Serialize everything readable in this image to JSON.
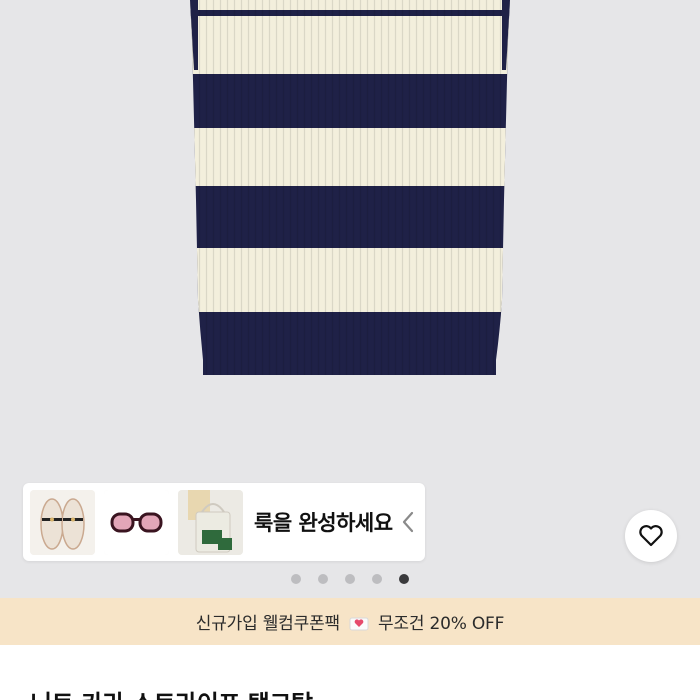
{
  "look_banner": {
    "text": "룩을 완성하세요",
    "thumbnails": [
      {
        "icon": "mary-jane-shoes-icon"
      },
      {
        "icon": "sunglasses-icon"
      },
      {
        "icon": "tote-bag-icon"
      }
    ]
  },
  "wishlist": {
    "icon": "heart-icon"
  },
  "carousel": {
    "total": 5,
    "active_index": 4
  },
  "promo": {
    "left_text": "신규가입 웰컴쿠폰팩",
    "icon": "gift-heart-icon",
    "right_text": "무조건 20% OFF"
  },
  "product": {
    "title": "니트 카라 스트라이프 탱크탑"
  },
  "colors": {
    "navy": "#1f2147",
    "cream": "#f3efdc",
    "background": "#e6e6e8",
    "promo_bg": "#f7e4c7"
  }
}
